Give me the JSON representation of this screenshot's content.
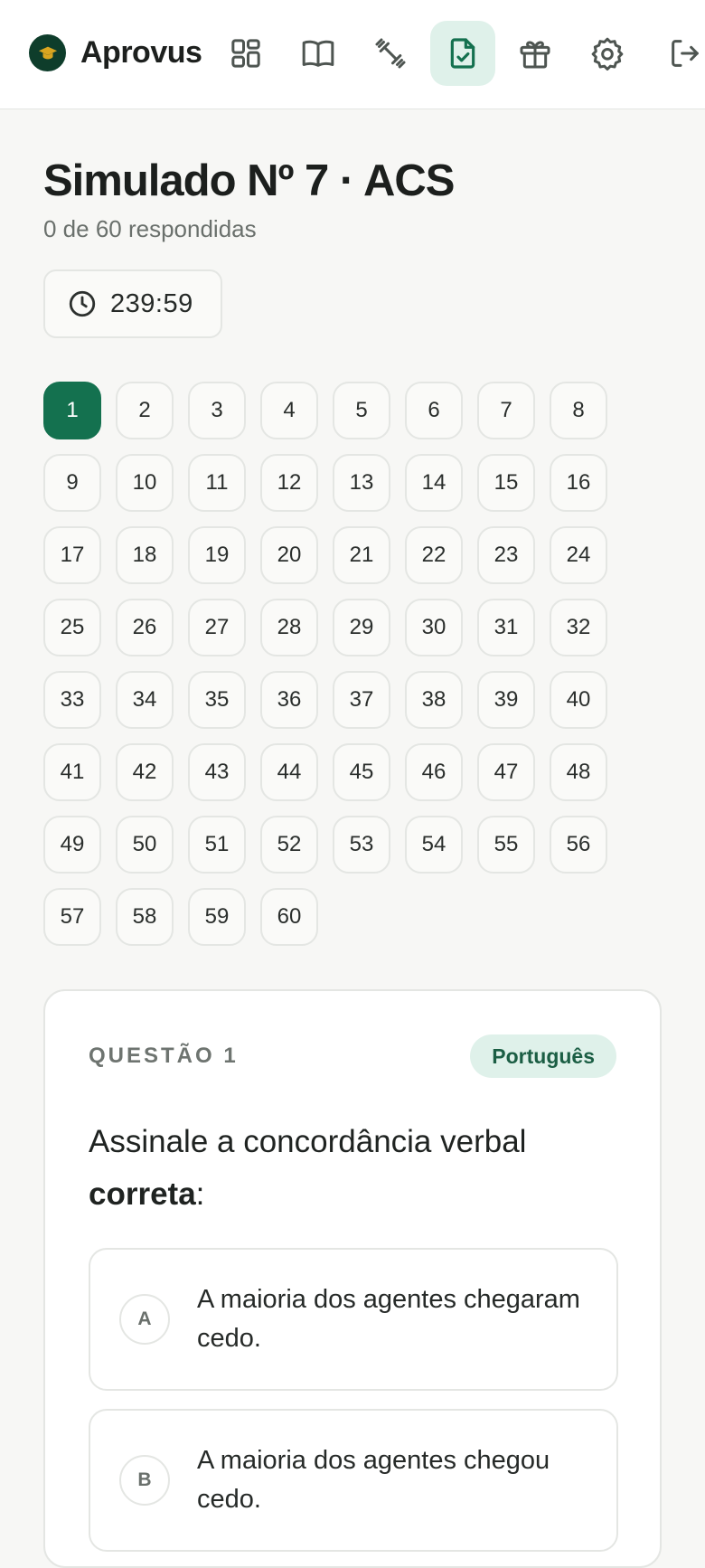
{
  "app": {
    "name": "Aprovus",
    "nav": [
      {
        "icon": "dashboard-icon",
        "active": false
      },
      {
        "icon": "book-icon",
        "active": false
      },
      {
        "icon": "dumbbell-icon",
        "active": false
      },
      {
        "icon": "exam-file-check-icon",
        "active": true
      },
      {
        "icon": "gift-icon",
        "active": false
      },
      {
        "icon": "settings-gear-icon",
        "active": false
      },
      {
        "icon": "logout-icon",
        "active": false
      }
    ]
  },
  "header": {
    "title": "Simulado Nº 7 · ACS",
    "subtitle": "0 de 60 respondidas",
    "timer": "239:59"
  },
  "grid": {
    "current": 1,
    "numbers": [
      "1",
      "2",
      "3",
      "4",
      "5",
      "6",
      "7",
      "8",
      "9",
      "10",
      "11",
      "12",
      "13",
      "14",
      "15",
      "16",
      "17",
      "18",
      "19",
      "20",
      "21",
      "22",
      "23",
      "24",
      "25",
      "26",
      "27",
      "28",
      "29",
      "30",
      "31",
      "32",
      "33",
      "34",
      "35",
      "36",
      "37",
      "38",
      "39",
      "40",
      "41",
      "42",
      "43",
      "44",
      "45",
      "46",
      "47",
      "48",
      "49",
      "50",
      "51",
      "52",
      "53",
      "54",
      "55",
      "56",
      "57",
      "58",
      "59",
      "60"
    ]
  },
  "question": {
    "label": "QUESTÃO 1",
    "subject": "Português",
    "text_main": "Assinale a concordância verbal ",
    "text_bold": "correta",
    "text_end": ":",
    "options": [
      {
        "letter": "A",
        "text": "A maioria dos agentes chegaram cedo."
      },
      {
        "letter": "B",
        "text": "A maioria dos agentes chegou cedo."
      }
    ]
  },
  "colors": {
    "accent": "#14714f",
    "accent_soft": "#dff1ea",
    "logo_bg": "#0e3d2b",
    "page_bg": "#f7f7f5"
  }
}
